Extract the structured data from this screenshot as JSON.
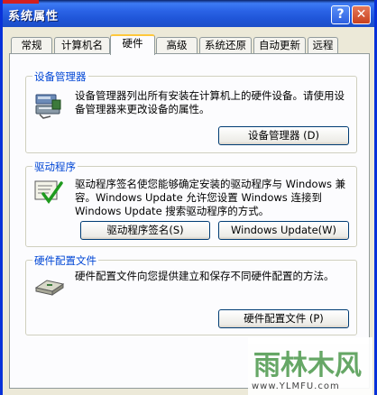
{
  "window": {
    "title": "系统属性",
    "help_label": "?",
    "close_label": "✕"
  },
  "tabs": [
    {
      "label": "常规"
    },
    {
      "label": "计算机名"
    },
    {
      "label": "硬件"
    },
    {
      "label": "高级"
    },
    {
      "label": "系统还原"
    },
    {
      "label": "自动更新"
    },
    {
      "label": "远程"
    }
  ],
  "active_tab": "硬件",
  "groups": {
    "device_manager": {
      "title": "设备管理器",
      "description": "设备管理器列出所有安装在计算机上的硬件设备。请使用设备管理器来更改设备的属性。",
      "button": "设备管理器 (D)",
      "icon": "device-manager-icon"
    },
    "drivers": {
      "title": "驱动程序",
      "description": "驱动程序签名使您能够确定安装的驱动程序与 Windows 兼容。Windows Update 允许您设置 Windows 连接到 Windows Update 搜索驱动程序的方式。",
      "button_signing": "驱动程序签名(S)",
      "button_update": "Windows Update(W)",
      "icon": "driver-signing-icon"
    },
    "hardware_profiles": {
      "title": "硬件配置文件",
      "description": "硬件配置文件向您提供建立和保存不同硬件配置的方法。",
      "button": "硬件配置文件 (P)",
      "icon": "hardware-profile-icon"
    }
  },
  "watermark": {
    "text": "雨林木风",
    "url": "www.YLMFU.com"
  },
  "colors": {
    "titlebar": "#2a63e6",
    "dialog_bg": "#ece9d8",
    "group_title": "#0046d5",
    "active_tab_accent": "#ffc83c"
  }
}
